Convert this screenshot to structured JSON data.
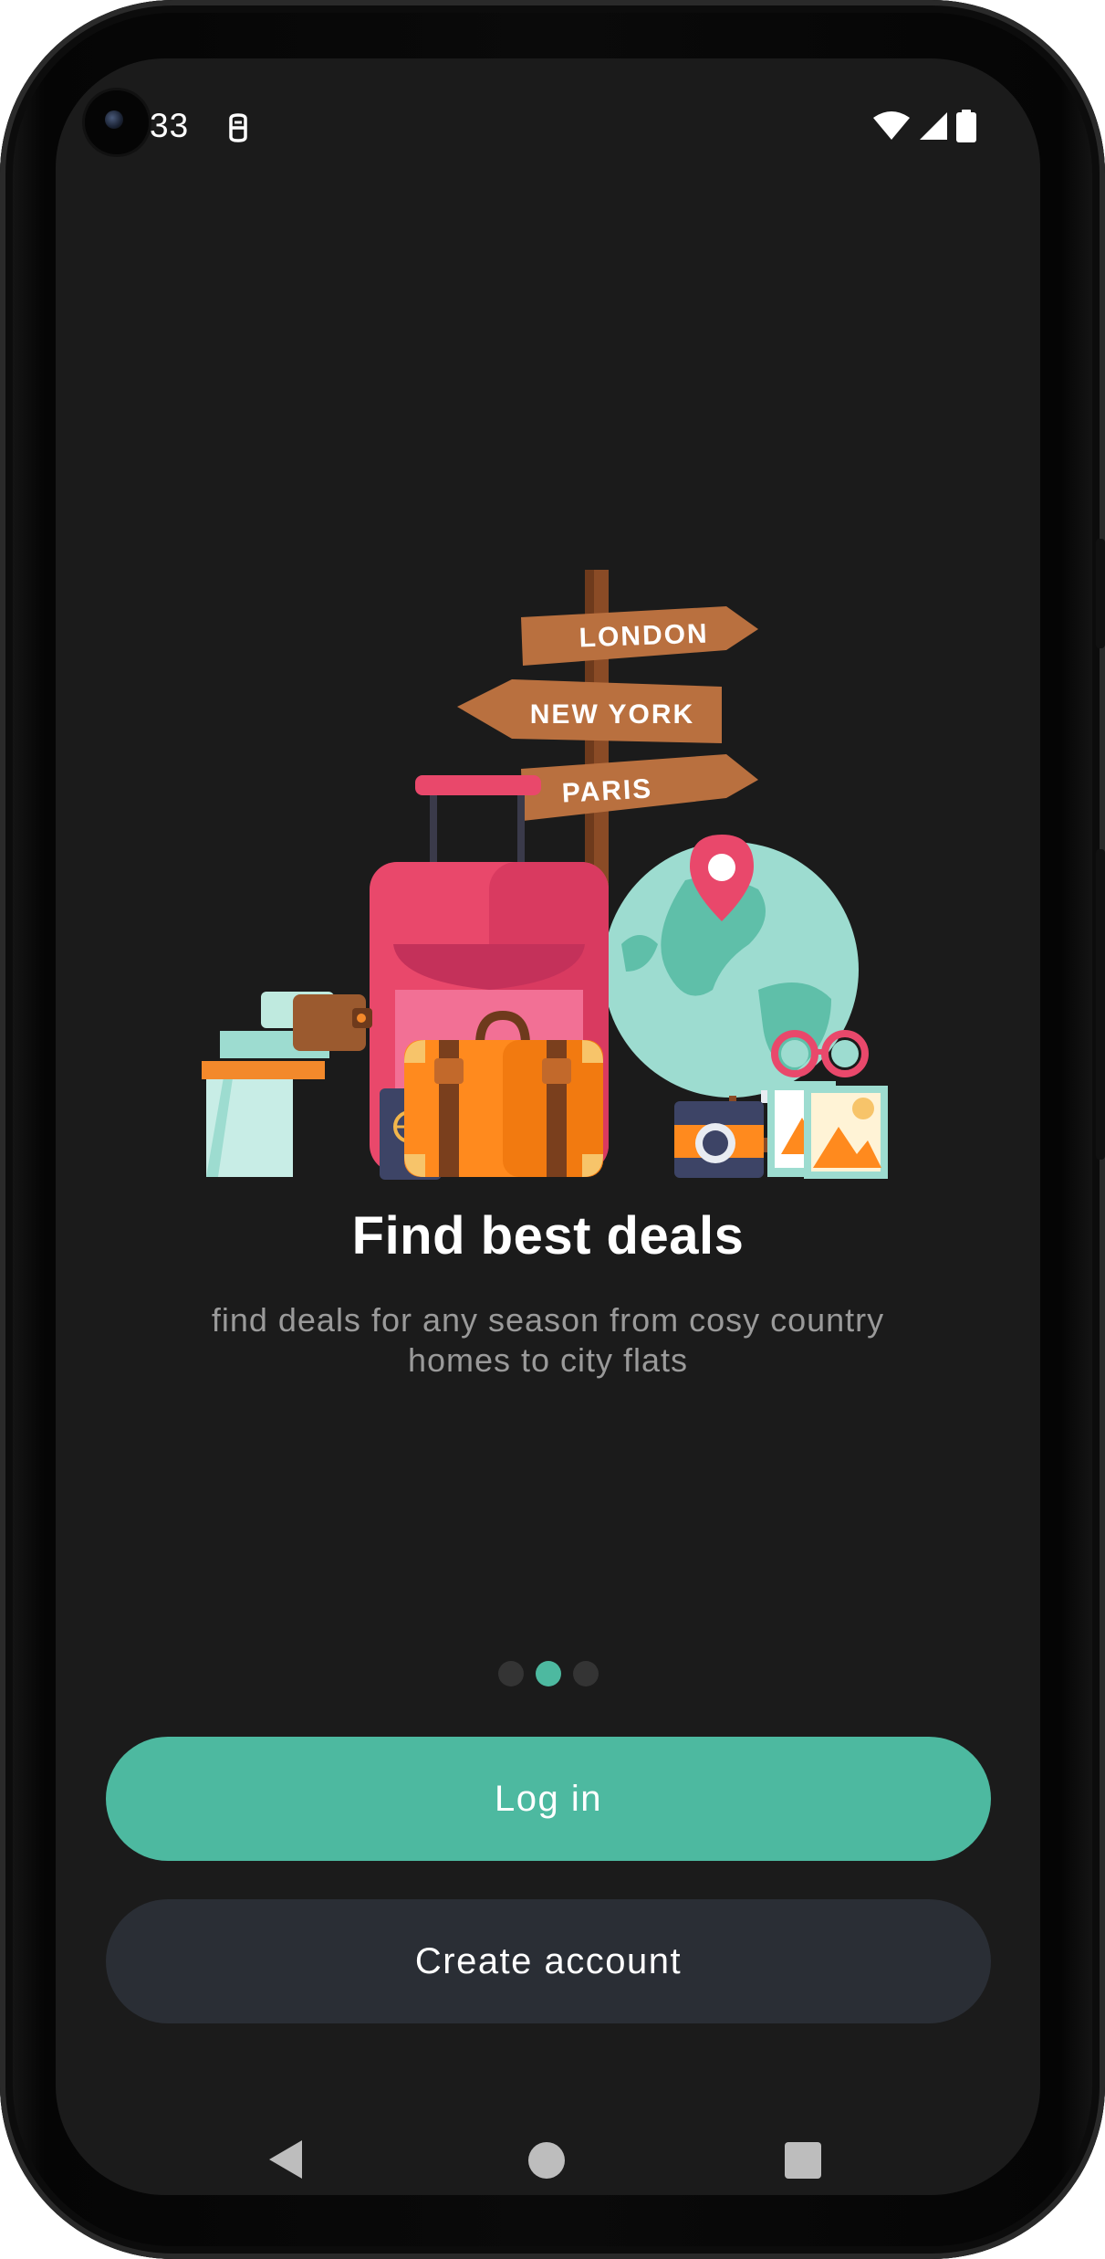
{
  "status_bar": {
    "time": "33",
    "left_icons": [
      "camera-hole",
      "mail-icon"
    ],
    "right_icons": [
      "wifi-icon",
      "signal-icon",
      "battery-icon"
    ]
  },
  "illustration": {
    "signs": [
      "LONDON",
      "NEW YORK",
      "PARIS"
    ]
  },
  "onboarding": {
    "title": "Find best deals",
    "subtitle": "find deals for any season from cosy country homes to city flats",
    "page_index": 1,
    "page_count": 3
  },
  "actions": {
    "login_label": "Log in",
    "create_label": "Create account"
  },
  "nav_bar": {
    "icons": [
      "back-icon",
      "home-icon",
      "recents-icon"
    ]
  },
  "colors": {
    "accent": "#4db9a0",
    "background": "#1b1b1b",
    "secondary_button": "#2a2e35",
    "subtitle_text": "#9a9a9a"
  }
}
